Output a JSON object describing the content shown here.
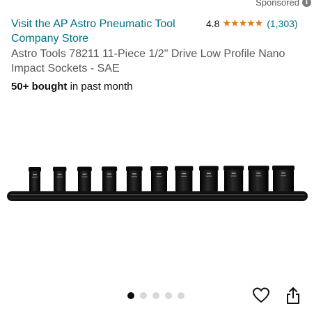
{
  "sponsored": {
    "label": "Sponsored",
    "icon": "info-icon"
  },
  "store": {
    "link_text": "Visit the AP Astro Pneumatic Tool Company Store"
  },
  "rating": {
    "value": "4.8",
    "stars": 5,
    "star_color": "#de7921",
    "count": "(1,303)"
  },
  "product": {
    "title": "Astro Tools 78211 11-Piece 1/2\" Drive Low Profile Nano Impact Sockets - SAE",
    "bought_bold": "50+ bought",
    "bought_rest": " in past month",
    "image_alt": "11-piece impact socket set on rail",
    "socket_count": 11
  },
  "carousel": {
    "total": 5,
    "active_index": 0
  },
  "actions": {
    "favorite_icon": "heart-icon",
    "share_icon": "share-icon"
  },
  "colors": {
    "link": "#007185",
    "text": "#0F1111",
    "muted": "#565959"
  }
}
